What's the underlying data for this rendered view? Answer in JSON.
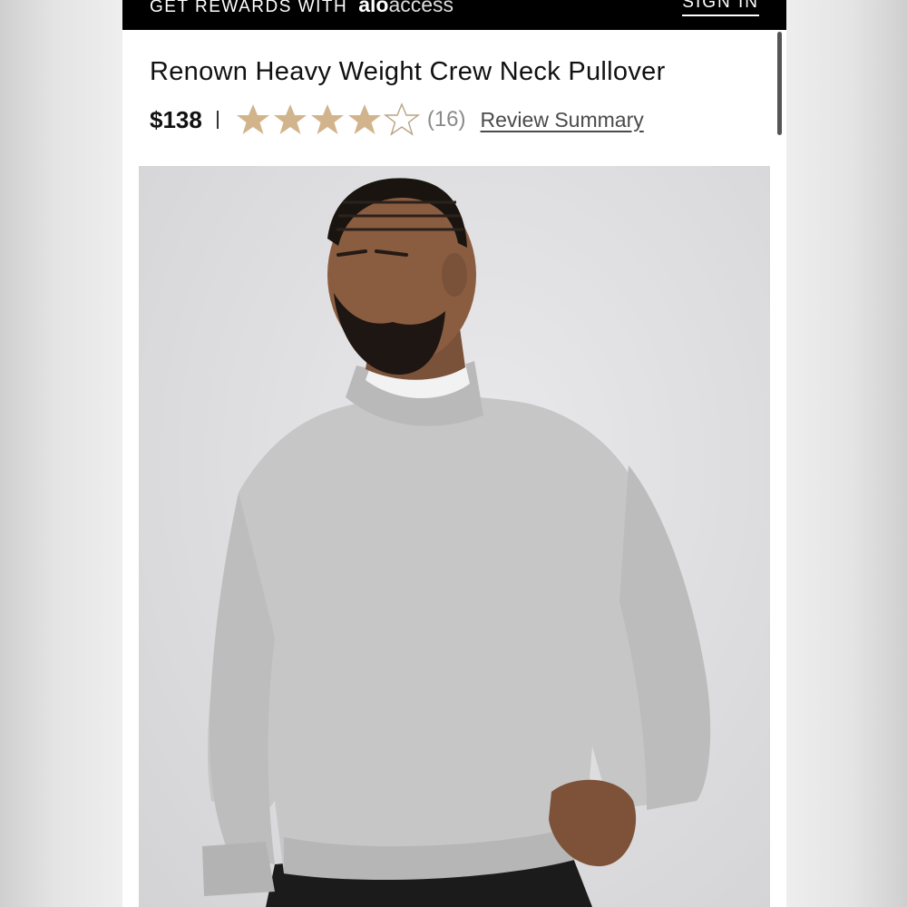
{
  "promo": {
    "text": "GET REWARDS WITH",
    "brand_bold": "alo",
    "brand_thin": "access",
    "signin_label": "SIGN IN"
  },
  "product": {
    "title": "Renown Heavy Weight Crew Neck Pullover",
    "price": "$138",
    "rating": {
      "value": 4,
      "max": 5,
      "count_text": "(16)",
      "filled_color": "#d2b48c",
      "empty_color": "#b9a384"
    },
    "review_summary_label": "Review Summary",
    "image": {
      "icon": "product-photo"
    }
  },
  "colors": {
    "promo_bg": "#000000",
    "star": "#d2b48c"
  }
}
